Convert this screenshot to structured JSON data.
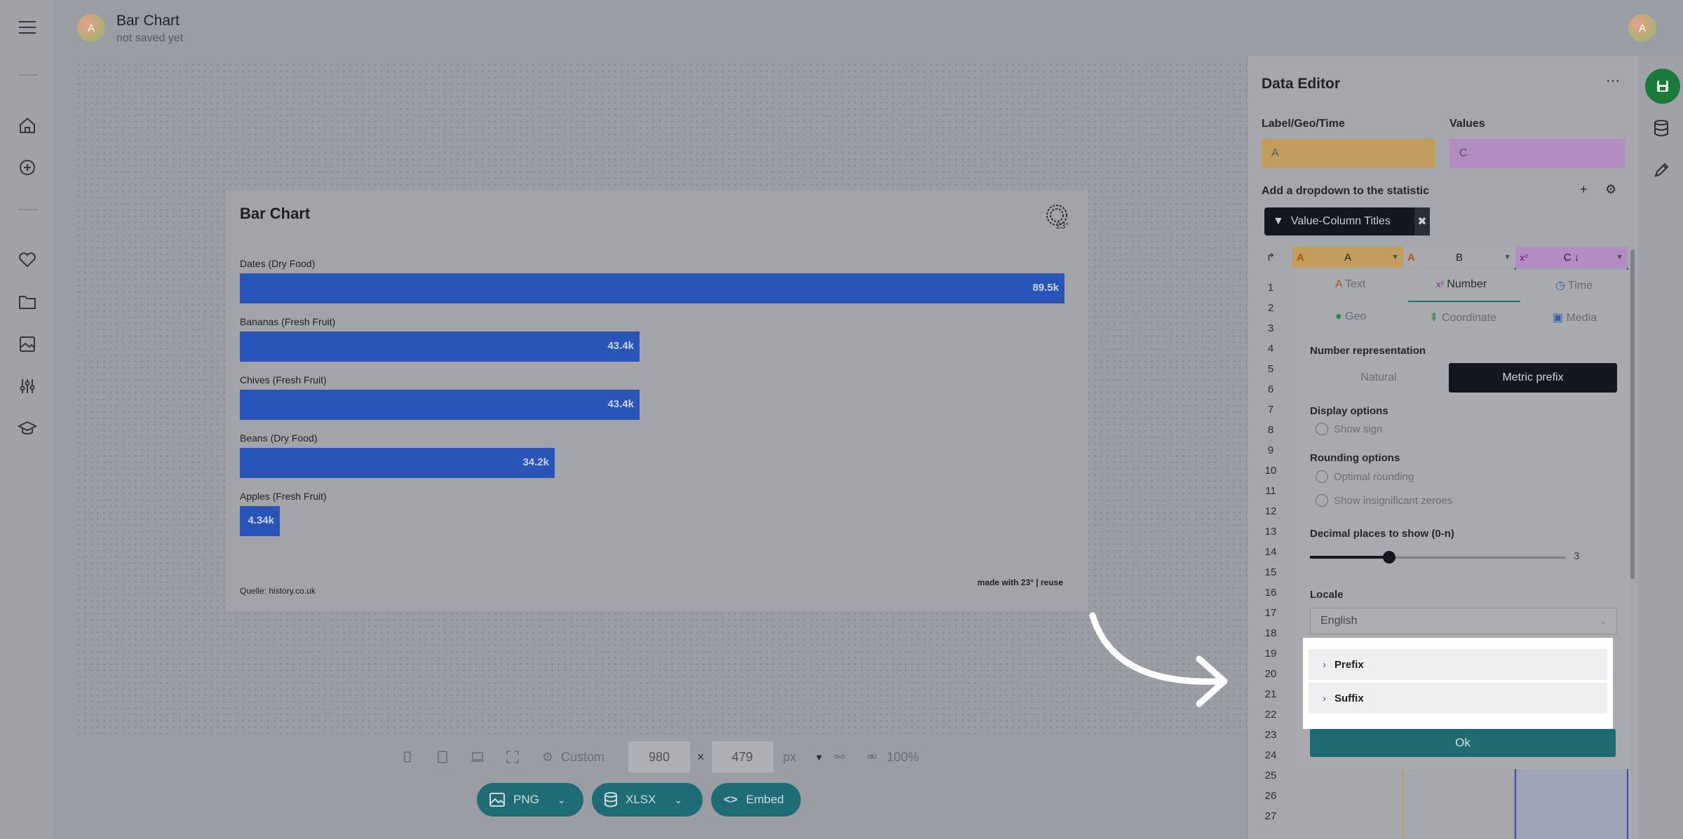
{
  "header": {
    "doc_title": "Bar Chart",
    "doc_status": "not saved yet",
    "avatar_initial": "A",
    "user_avatar_initial": "A"
  },
  "sidebar": {
    "icons": [
      "menu-icon",
      "home-icon",
      "add-icon",
      "heart-icon",
      "folder-icon",
      "image-icon",
      "sliders-icon",
      "graduation-cap-icon"
    ]
  },
  "chart": {
    "title": "Bar Chart",
    "logo_text": "23°",
    "source": "Quelle: history.co.uk",
    "made_with": "made with 23° | reuse"
  },
  "chart_data": {
    "type": "bar",
    "orientation": "horizontal",
    "categories": [
      "Dates (Dry Food)",
      "Bananas (Fresh Fruit)",
      "Chives (Fresh Fruit)",
      "Beans (Dry Food)",
      "Apples (Fresh Fruit)"
    ],
    "values": [
      89500,
      43400,
      43400,
      34200,
      4340
    ],
    "value_labels": [
      "89.5k",
      "43.4k",
      "43.4k",
      "34.2k",
      "4.34k"
    ],
    "title": "Bar Chart",
    "color": "#2a55b8",
    "xlim": [
      0,
      89500
    ]
  },
  "size_toolbar": {
    "preset": "Custom",
    "width": "980",
    "times": "×",
    "height": "479",
    "unit": "px",
    "zoom": "100%"
  },
  "export": {
    "png": "PNG",
    "xlsx": "XLSX",
    "embed": "Embed"
  },
  "editor": {
    "title": "Data Editor",
    "more": "···",
    "label_col_title": "Label/Geo/Time",
    "label_col_value": "A",
    "values_title": "Values",
    "values_value": "C",
    "dropdown_label": "Add a dropdown to the statistic",
    "plus": "+",
    "chip_label": "Value-Column Titles",
    "chip_close": "✖",
    "columns": [
      {
        "name": "A",
        "type_glyph": "A",
        "color": "#c99a5c"
      },
      {
        "name": "B",
        "type_glyph": "A",
        "color": "#a8aaae"
      },
      {
        "name": "C ↓",
        "type_glyph": "x²",
        "color": "#b78ac6"
      }
    ],
    "rows": [
      "1",
      "2",
      "3",
      "4",
      "5",
      "6",
      "7",
      "8",
      "9",
      "10",
      "11",
      "12",
      "13",
      "14",
      "15",
      "16",
      "17",
      "18",
      "19",
      "20",
      "21",
      "22",
      "23",
      "24",
      "25",
      "26",
      "27"
    ]
  },
  "type_popup": {
    "tabs": [
      {
        "label": "Text",
        "glyph": "A"
      },
      {
        "label": "Number",
        "glyph": "x²"
      },
      {
        "label": "Time",
        "glyph": "◷"
      },
      {
        "label": "Geo",
        "glyph": "●"
      },
      {
        "label": "Coordinate",
        "glyph": "⇞"
      },
      {
        "label": "Media",
        "glyph": "▣"
      }
    ],
    "active_tab": "Number",
    "number_repr_label": "Number representation",
    "repr_natural": "Natural",
    "repr_metric": "Metric prefix",
    "display_options_label": "Display options",
    "show_sign": "Show sign",
    "rounding_label": "Rounding options",
    "optimal_rounding": "Optimal rounding",
    "show_zeroes": "Show insignificant zeroes",
    "decimal_label": "Decimal places to show (0-n)",
    "decimal_value": "3",
    "decimal_fraction": 0.3,
    "locale_label": "Locale",
    "locale_value": "English",
    "prefix": "Prefix",
    "suffix": "Suffix",
    "ok": "Ok"
  },
  "colors": {
    "accent": "#1e6b72",
    "save": "#1a7a3a",
    "bar": "#2a55b8"
  }
}
